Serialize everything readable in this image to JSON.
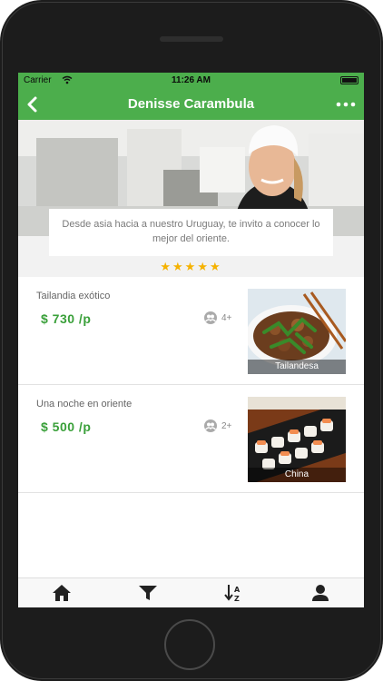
{
  "status_bar": {
    "carrier": "Carrier",
    "time": "11:26 AM"
  },
  "header": {
    "title": "Denisse Carambula",
    "back_icon": "chevron-left-icon",
    "more_icon": "more-icon"
  },
  "profile": {
    "description": "Desde asia hacia a nuestro Uruguay, te invito a conocer lo mejor del oriente.",
    "rating": 5,
    "rating_stars": "★★★★★"
  },
  "experiences": [
    {
      "name": "Tailandia exótico",
      "price": "$ 730 /p",
      "guests": "4+",
      "category": "Tailandesa"
    },
    {
      "name": "Una noche en oriente",
      "price": "$ 500 /p",
      "guests": "2+",
      "category": "China"
    }
  ],
  "tabs": [
    {
      "icon": "home-icon"
    },
    {
      "icon": "filter-icon"
    },
    {
      "icon": "sort-az-icon"
    },
    {
      "icon": "profile-icon"
    }
  ],
  "colors": {
    "brand_green": "#4cae4c",
    "price_green": "#3aa03a",
    "star_gold": "#f5b200"
  }
}
